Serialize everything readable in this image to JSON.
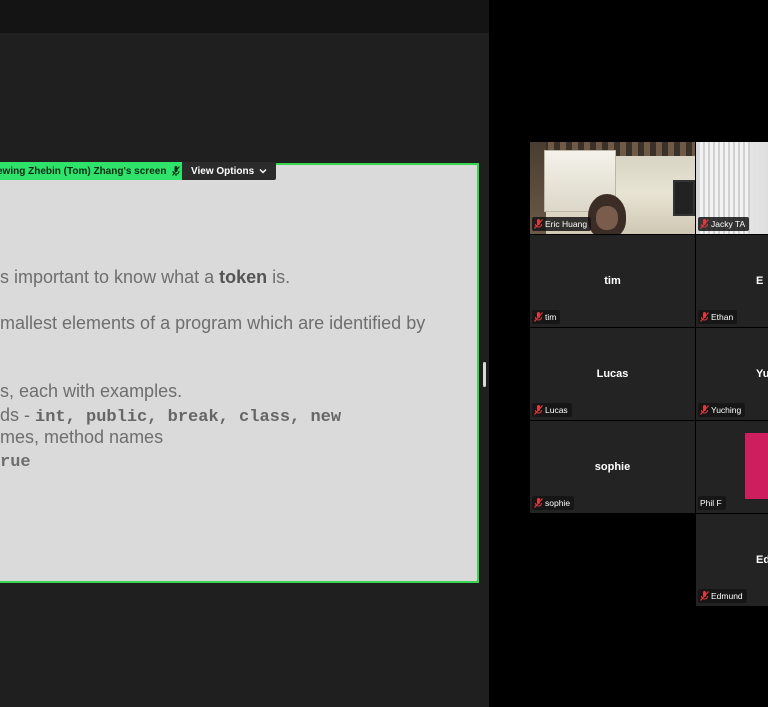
{
  "share_bar": {
    "label": "ewing  Zhebin (Tom) Zhang's screen",
    "view_options_label": "View Options"
  },
  "slide": {
    "line1_pre": "s important to know what a ",
    "line1_bold": "token",
    "line1_post": " is.",
    "line2": "mallest elements of a program which are identified by",
    "line3": "s, each with examples.",
    "line4_pre": "ds - ",
    "line4_code": "int, public, break, class, new",
    "line5": "mes, method names",
    "line6": "rue"
  },
  "participants": [
    {
      "tag": "Eric Huang",
      "muted": true,
      "video": true
    },
    {
      "tag": "Jacky TA",
      "muted": true,
      "video": true
    },
    {
      "center": "tim",
      "tag": "tim",
      "muted": true
    },
    {
      "center": "E",
      "tag": "Ethan",
      "muted": true
    },
    {
      "center": "Lucas",
      "tag": "Lucas",
      "muted": true
    },
    {
      "center": "Yu",
      "tag": "Yuching",
      "muted": true
    },
    {
      "center": "sophie",
      "tag": "sophie",
      "muted": true
    },
    {
      "tag": "Phil F",
      "muted": false
    },
    {
      "center": "Ed",
      "tag": "Edmund",
      "muted": true
    }
  ],
  "colors": {
    "share_green": "#2ee26a",
    "slide_border": "#37d44f",
    "mute_red": "#e0393e",
    "pink_tile": "#cf1e5e"
  },
  "icons": {
    "mic": "mic-icon",
    "muted_mic": "muted-mic-icon",
    "chevron": "chevron-down-icon"
  }
}
